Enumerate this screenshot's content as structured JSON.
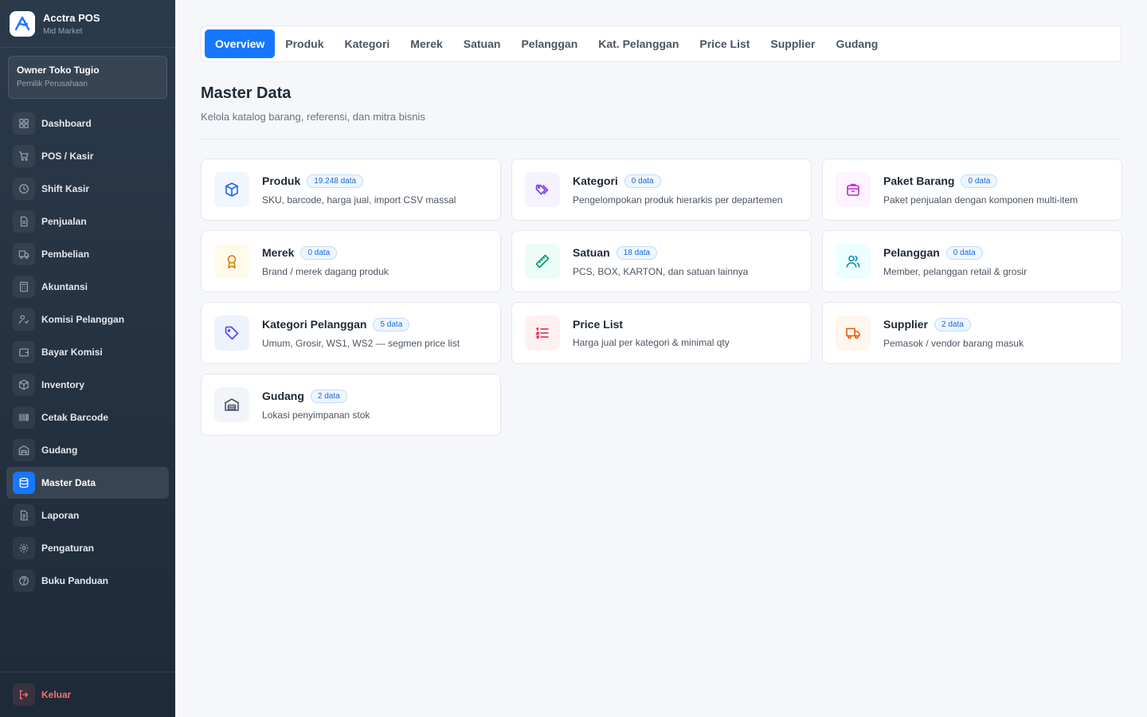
{
  "brand": {
    "name": "Acctra POS",
    "tier": "Mid Market"
  },
  "user": {
    "name": "Owner Toko Tugio",
    "role": "Pemilik Perusahaan"
  },
  "sidebar": {
    "items": [
      {
        "label": "Dashboard",
        "icon": "grid-icon"
      },
      {
        "label": "POS / Kasir",
        "icon": "cart-icon"
      },
      {
        "label": "Shift Kasir",
        "icon": "clock-icon"
      },
      {
        "label": "Penjualan",
        "icon": "document-icon"
      },
      {
        "label": "Pembelian",
        "icon": "truck-icon"
      },
      {
        "label": "Akuntansi",
        "icon": "calculator-icon"
      },
      {
        "label": "Komisi Pelanggan",
        "icon": "user-check-icon"
      },
      {
        "label": "Bayar Komisi",
        "icon": "wallet-icon"
      },
      {
        "label": "Inventory",
        "icon": "box-icon"
      },
      {
        "label": "Cetak Barcode",
        "icon": "barcode-icon"
      },
      {
        "label": "Gudang",
        "icon": "warehouse-icon"
      },
      {
        "label": "Master Data",
        "icon": "database-icon",
        "active": true
      },
      {
        "label": "Laporan",
        "icon": "report-icon"
      },
      {
        "label": "Pengaturan",
        "icon": "gear-icon"
      },
      {
        "label": "Buku Panduan",
        "icon": "help-icon"
      }
    ],
    "logout": "Keluar"
  },
  "tabs": [
    "Overview",
    "Produk",
    "Kategori",
    "Merek",
    "Satuan",
    "Pelanggan",
    "Kat. Pelanggan",
    "Price List",
    "Supplier",
    "Gudang"
  ],
  "active_tab": "Overview",
  "page": {
    "title": "Master Data",
    "subtitle": "Kelola katalog barang, referensi, dan mitra bisnis"
  },
  "cards": [
    {
      "title": "Produk",
      "badge": "19.248 data",
      "desc": "SKU, barcode, harga jual, import CSV massal",
      "icon": "box-icon",
      "color": "#2563eb",
      "bg": "#eff6ff"
    },
    {
      "title": "Kategori",
      "badge": "0 data",
      "desc": "Pengelompokan produk hierarkis per departemen",
      "icon": "tags-icon",
      "color": "#7c3aed",
      "bg": "#f5f3ff"
    },
    {
      "title": "Paket Barang",
      "badge": "0 data",
      "desc": "Paket penjualan dengan komponen multi-item",
      "icon": "package-icon",
      "color": "#c026d3",
      "bg": "#fdf4ff"
    },
    {
      "title": "Merek",
      "badge": "0 data",
      "desc": "Brand / merek dagang produk",
      "icon": "award-icon",
      "color": "#d97706",
      "bg": "#fffbeb"
    },
    {
      "title": "Satuan",
      "badge": "18 data",
      "desc": "PCS, BOX, KARTON, dan satuan lainnya",
      "icon": "ruler-icon",
      "color": "#059669",
      "bg": "#ecfdf5"
    },
    {
      "title": "Pelanggan",
      "badge": "0 data",
      "desc": "Member, pelanggan retail & grosir",
      "icon": "users-icon",
      "color": "#0891b2",
      "bg": "#ecfeff"
    },
    {
      "title": "Kategori Pelanggan",
      "badge": "5 data",
      "desc": "Umum, Grosir, WS1, WS2 — segmen price list",
      "icon": "tag-icon",
      "color": "#4f46e5",
      "bg": "#eef2ff"
    },
    {
      "title": "Price List",
      "badge": "",
      "desc": "Harga jual per kategori & minimal qty",
      "icon": "list-icon",
      "color": "#e11d48",
      "bg": "#fff1f2"
    },
    {
      "title": "Supplier",
      "badge": "2 data",
      "desc": "Pemasok / vendor barang masuk",
      "icon": "truck-icon",
      "color": "#ea580c",
      "bg": "#fff7ed"
    },
    {
      "title": "Gudang",
      "badge": "2 data",
      "desc": "Lokasi penyimpanan stok",
      "icon": "warehouse-icon",
      "color": "#475569",
      "bg": "#f1f5f9"
    }
  ]
}
